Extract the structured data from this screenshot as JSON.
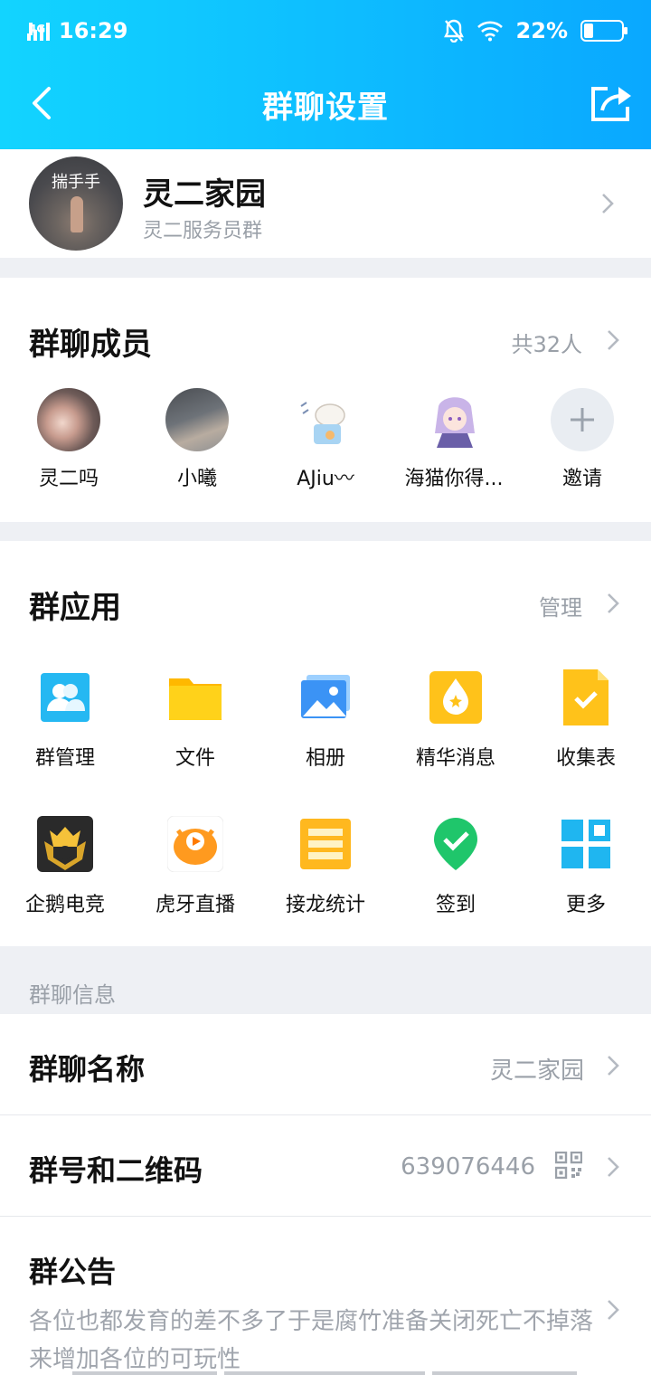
{
  "status": {
    "network": "4G",
    "time": "16:29",
    "battery": "22%"
  },
  "nav": {
    "title": "群聊设置"
  },
  "group": {
    "avatar_text": "揣手手",
    "name": "灵二家园",
    "subtitle": "灵二服务员群"
  },
  "members": {
    "title": "群聊成员",
    "count": "共32人",
    "list": [
      {
        "name": "灵二吗"
      },
      {
        "name": "小曦"
      },
      {
        "name": "AJiu〰"
      },
      {
        "name": "海猫你得..."
      },
      {
        "name": "邀请"
      }
    ]
  },
  "apps": {
    "title": "群应用",
    "manage": "管理",
    "items": [
      {
        "label": "群管理",
        "icon": "group-manage-icon"
      },
      {
        "label": "文件",
        "icon": "folder-icon"
      },
      {
        "label": "相册",
        "icon": "album-icon"
      },
      {
        "label": "精华消息",
        "icon": "essence-icon"
      },
      {
        "label": "收集表",
        "icon": "form-icon"
      },
      {
        "label": "企鹅电竞",
        "icon": "penguin-esports-icon"
      },
      {
        "label": "虎牙直播",
        "icon": "huya-icon"
      },
      {
        "label": "接龙统计",
        "icon": "list-stats-icon"
      },
      {
        "label": "签到",
        "icon": "checkin-icon"
      },
      {
        "label": "更多",
        "icon": "more-grid-icon"
      }
    ]
  },
  "info": {
    "section_label": "群聊信息",
    "name_label": "群聊名称",
    "name_value": "灵二家园",
    "number_label": "群号和二维码",
    "number_value": "639076446",
    "notice_label": "群公告",
    "notice_text": "各位也都发育的差不多了于是腐竹准备关闭死亡不掉落来增加各位的可玩性"
  },
  "colors": {
    "header_start": "#12d4ff",
    "header_end": "#0aa8ff"
  }
}
